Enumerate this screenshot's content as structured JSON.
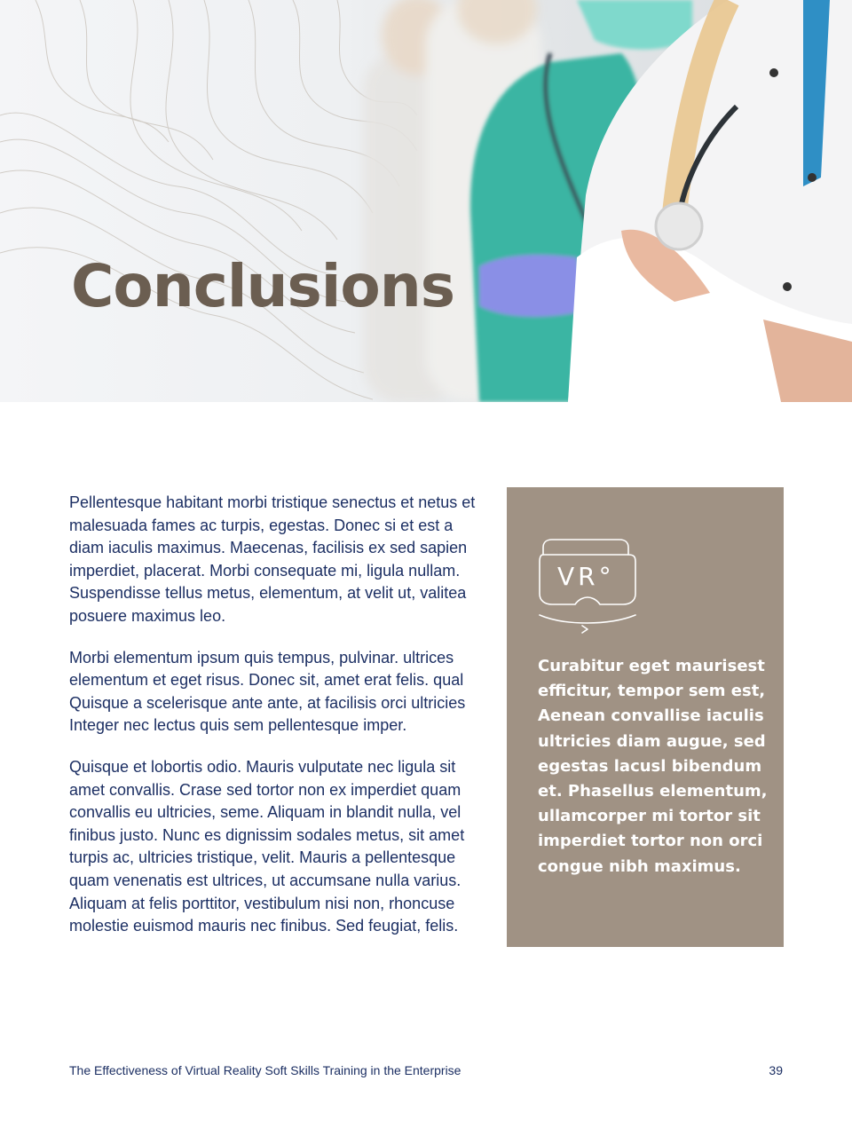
{
  "header": {
    "title": "Conclusions"
  },
  "body": {
    "paragraphs": [
      "Pellentesque habitant morbi tristique senectus et netus et malesuada fames ac turpis, egestas. Donec si et est a diam iaculis maximus. Maecenas, facilisis ex sed sapien imperdiet, placerat. Morbi consequate mi, ligula nullam. Suspendisse tellus metus, elementum, at velit ut, valitea posuere maximus leo.",
      "Morbi elementum ipsum quis tempus, pulvinar. ultrices elementum et eget risus. Donec sit, amet erat felis. qual Quisque a scelerisque ante ante, at facilisis orci ultricies Integer nec lectus quis sem pellentesque imper.",
      "Quisque et lobortis odio. Mauris vulputate nec ligula sit amet convallis. Crase sed tortor non ex imperdiet quam convallis eu ultricies, seme. Aliquam in blandit nulla, vel finibus justo. Nunc es dignissim sodales metus, sit amet turpis ac, ultricies tristique, velit. Mauris a pellentesque quam venenatis est ultrices, ut accumsane nulla varius. Aliquam at felis porttitor, vestibulum nisi non, rhoncuse molestie euismod mauris nec finibus. Sed feugiat, felis."
    ]
  },
  "callout": {
    "icon": "vr-headset-icon",
    "icon_text": "VR°",
    "text": "Curabitur eget maurisest efficitur, tempor sem est, Aenean convallise iaculis ultricies diam augue, sed egestas lacusl bibendum et. Phasellus elementum, ullamcorper mi tortor sit imperdiet tortor non orci congue nibh maximus.",
    "background": "#a09284"
  },
  "footer": {
    "document_title": "The Effectiveness of Virtual Reality Soft Skills Training in the Enterprise",
    "page_number": "39"
  },
  "colors": {
    "title": "#6b5e51",
    "body_text": "#1c2f63",
    "callout_bg": "#a09284"
  }
}
